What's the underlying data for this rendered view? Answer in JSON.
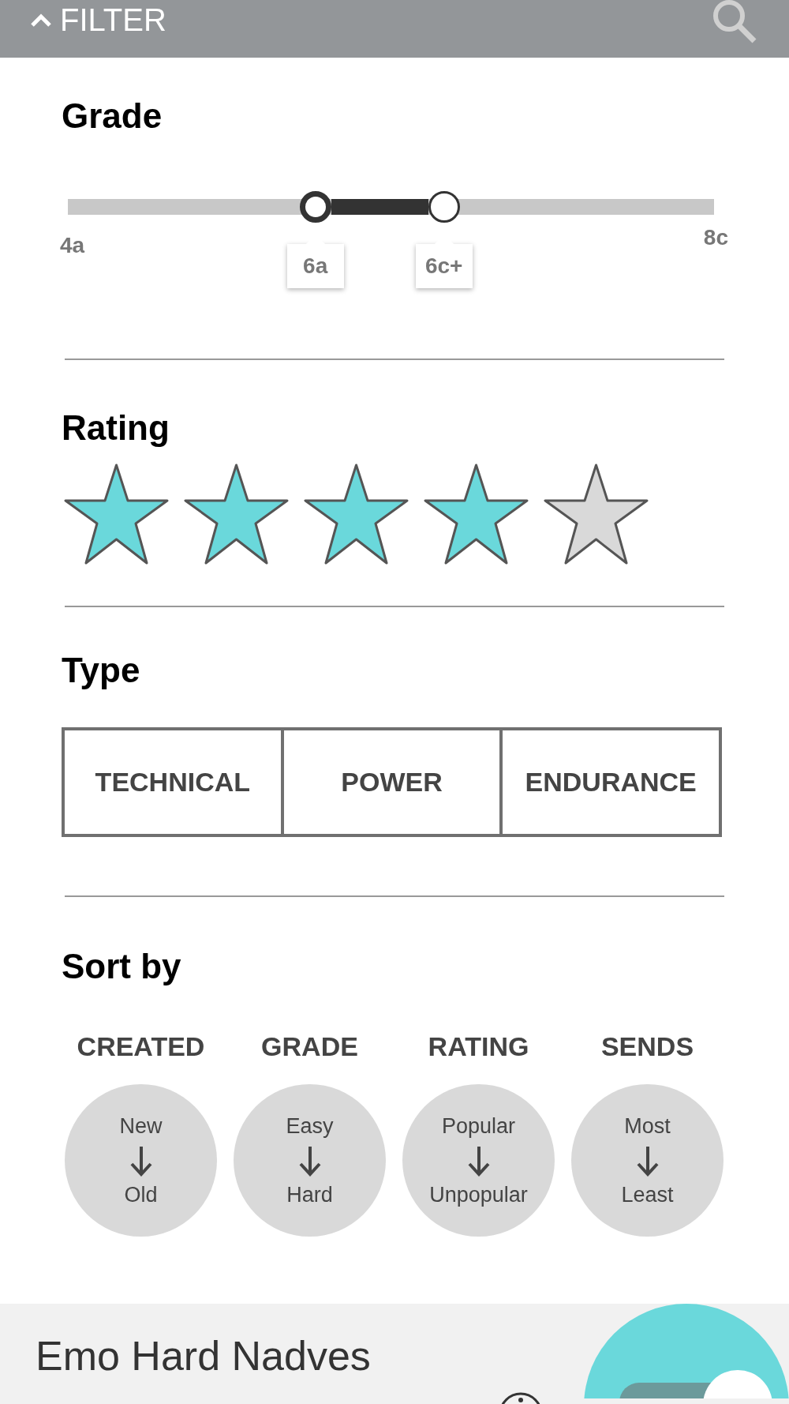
{
  "header": {
    "title": "FILTER"
  },
  "grade": {
    "title": "Grade",
    "min_label": "4a",
    "max_label": "8c",
    "thumbs": [
      {
        "label": "6a",
        "level": 0.383,
        "selected": true
      },
      {
        "label": "6c+",
        "level": 0.582,
        "selected": false
      }
    ]
  },
  "rating": {
    "title": "Rating",
    "stars": 4
  },
  "type": {
    "title": "Type",
    "options": [
      "TECHNICAL",
      "POWER",
      "ENDURANCE"
    ]
  },
  "sort": {
    "title": "Sort by",
    "columns": [
      {
        "label": "CREATED",
        "from": "New",
        "to": "Old"
      },
      {
        "label": "GRADE",
        "from": "Easy",
        "to": "Hard"
      },
      {
        "label": "RATING",
        "from": "Popular",
        "to": "Unpopular"
      },
      {
        "label": "SENDS",
        "from": "Most",
        "to": "Least"
      }
    ]
  },
  "card": {
    "title": "Emo Hard Nadves"
  }
}
